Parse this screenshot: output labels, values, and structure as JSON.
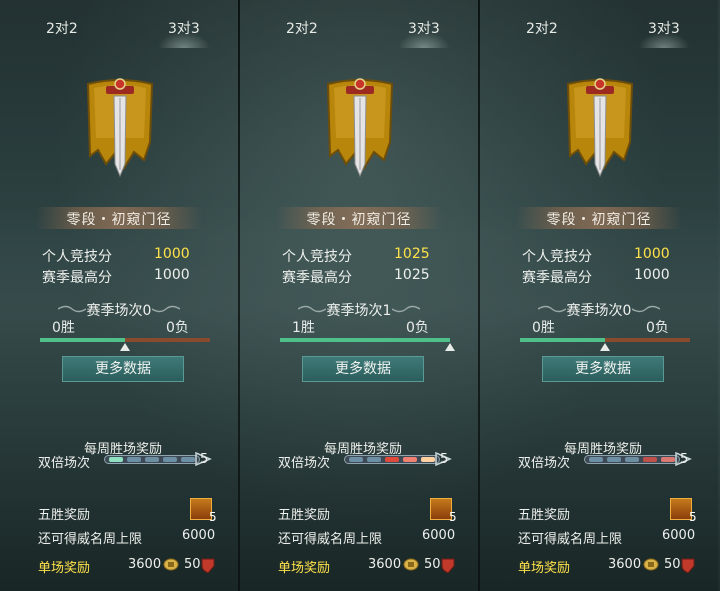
{
  "panels": [
    {
      "tabs": {
        "left": "2对2",
        "right": "3对3",
        "active": "right"
      },
      "rank_name": "零段・初窥门径",
      "personal_score_label": "个人竞技分",
      "personal_score": "1000",
      "season_high_label": "赛季最高分",
      "season_high": "1000",
      "season_matches": "赛季场次0",
      "wins": "0胜",
      "losses": "0负",
      "win_fraction": 0.5,
      "more_button": "更多数据",
      "weekly_title": "每周胜场奖励",
      "double_label": "双倍场次",
      "double_count": "5",
      "five_win_label": "五胜奖励",
      "chest_count": "5",
      "cap_label": "还可得威名周上限",
      "cap_value": "6000",
      "single_label": "单场奖励",
      "single_gold": "3600",
      "single_fame": "50"
    },
    {
      "tabs": {
        "left": "2对2",
        "right": "3对3",
        "active": "right"
      },
      "rank_name": "零段・初窥门径",
      "personal_score_label": "个人竞技分",
      "personal_score": "1025",
      "season_high_label": "赛季最高分",
      "season_high": "1025",
      "season_matches": "赛季场次1",
      "wins": "1胜",
      "losses": "0负",
      "win_fraction": 1.0,
      "more_button": "更多数据",
      "weekly_title": "每周胜场奖励",
      "double_label": "双倍场次",
      "double_count": "5",
      "five_win_label": "五胜奖励",
      "chest_count": "5",
      "cap_label": "还可得威名周上限",
      "cap_value": "6000",
      "single_label": "单场奖励",
      "single_gold": "3600",
      "single_fame": "50"
    },
    {
      "tabs": {
        "left": "2对2",
        "right": "3对3",
        "active": "right"
      },
      "rank_name": "零段・初窥门径",
      "personal_score_label": "个人竞技分",
      "personal_score": "1000",
      "season_high_label": "赛季最高分",
      "season_high": "1000",
      "season_matches": "赛季场次0",
      "wins": "0胜",
      "losses": "0负",
      "win_fraction": 0.5,
      "more_button": "更多数据",
      "weekly_title": "每周胜场奖励",
      "double_label": "双倍场次",
      "double_count": "5",
      "five_win_label": "五胜奖励",
      "chest_count": "5",
      "cap_label": "还可得威名周上限",
      "cap_value": "6000",
      "single_label": "单场奖励",
      "single_gold": "3600",
      "single_fame": "50"
    }
  ],
  "colors": {
    "highlight_score": "#ffe24a",
    "win_track": "#4fc08a",
    "loss_track": "#8a4a2e",
    "button": "#2b5e5d"
  },
  "icons": [
    "sword-banner-emblem-icon",
    "ornament-icon",
    "chest-icon",
    "gold-coin-icon",
    "fame-shield-icon"
  ]
}
